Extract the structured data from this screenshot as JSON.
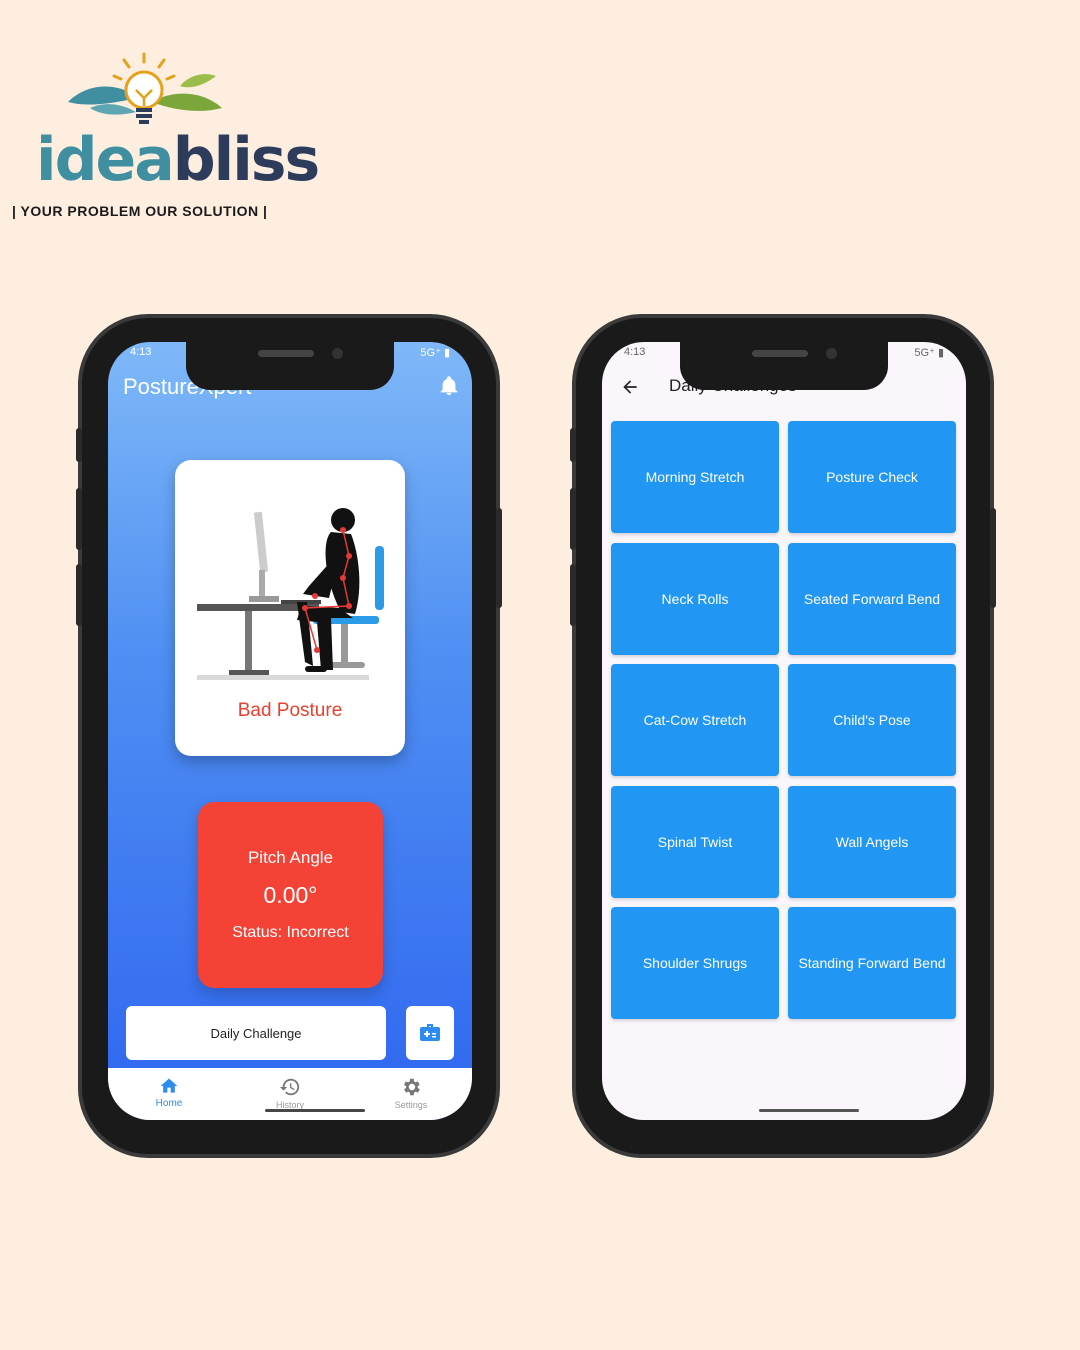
{
  "brand": {
    "name_part1": "idea",
    "name_part2": "bliss",
    "tagline": "| YOUR PROBLEM OUR SOLUTION |"
  },
  "left_phone": {
    "status_time": "4:13",
    "status_right": "5G⁺ ▮",
    "app_title": "PostureXpert",
    "notification_icon": "bell-icon",
    "posture_card": {
      "label": "Bad Posture"
    },
    "pitch_card": {
      "title": "Pitch Angle",
      "value": "0.00°",
      "status": "Status: Incorrect"
    },
    "daily_challenge_button": "Daily Challenge",
    "bottom_nav": [
      {
        "label": "Home",
        "icon": "home-icon",
        "active": true
      },
      {
        "label": "History",
        "icon": "history-icon",
        "active": false
      },
      {
        "label": "Settings",
        "icon": "gear-icon",
        "active": false
      }
    ]
  },
  "right_phone": {
    "status_time": "4:13",
    "status_right": "5G⁺ ▮",
    "header_title": "Daily Challenges",
    "challenges": [
      "Morning Stretch",
      "Posture Check",
      "Neck Rolls",
      "Seated Forward Bend",
      "Cat-Cow Stretch",
      "Child's Pose",
      "Spinal Twist",
      "Wall Angels",
      "Shoulder Shrugs",
      "Standing Forward Bend"
    ]
  },
  "colors": {
    "background": "#fdeee0",
    "primary_blue": "#2196f3",
    "alert_red": "#f44336",
    "brand_teal": "#3f8fa0",
    "brand_navy": "#2e3c5c"
  }
}
